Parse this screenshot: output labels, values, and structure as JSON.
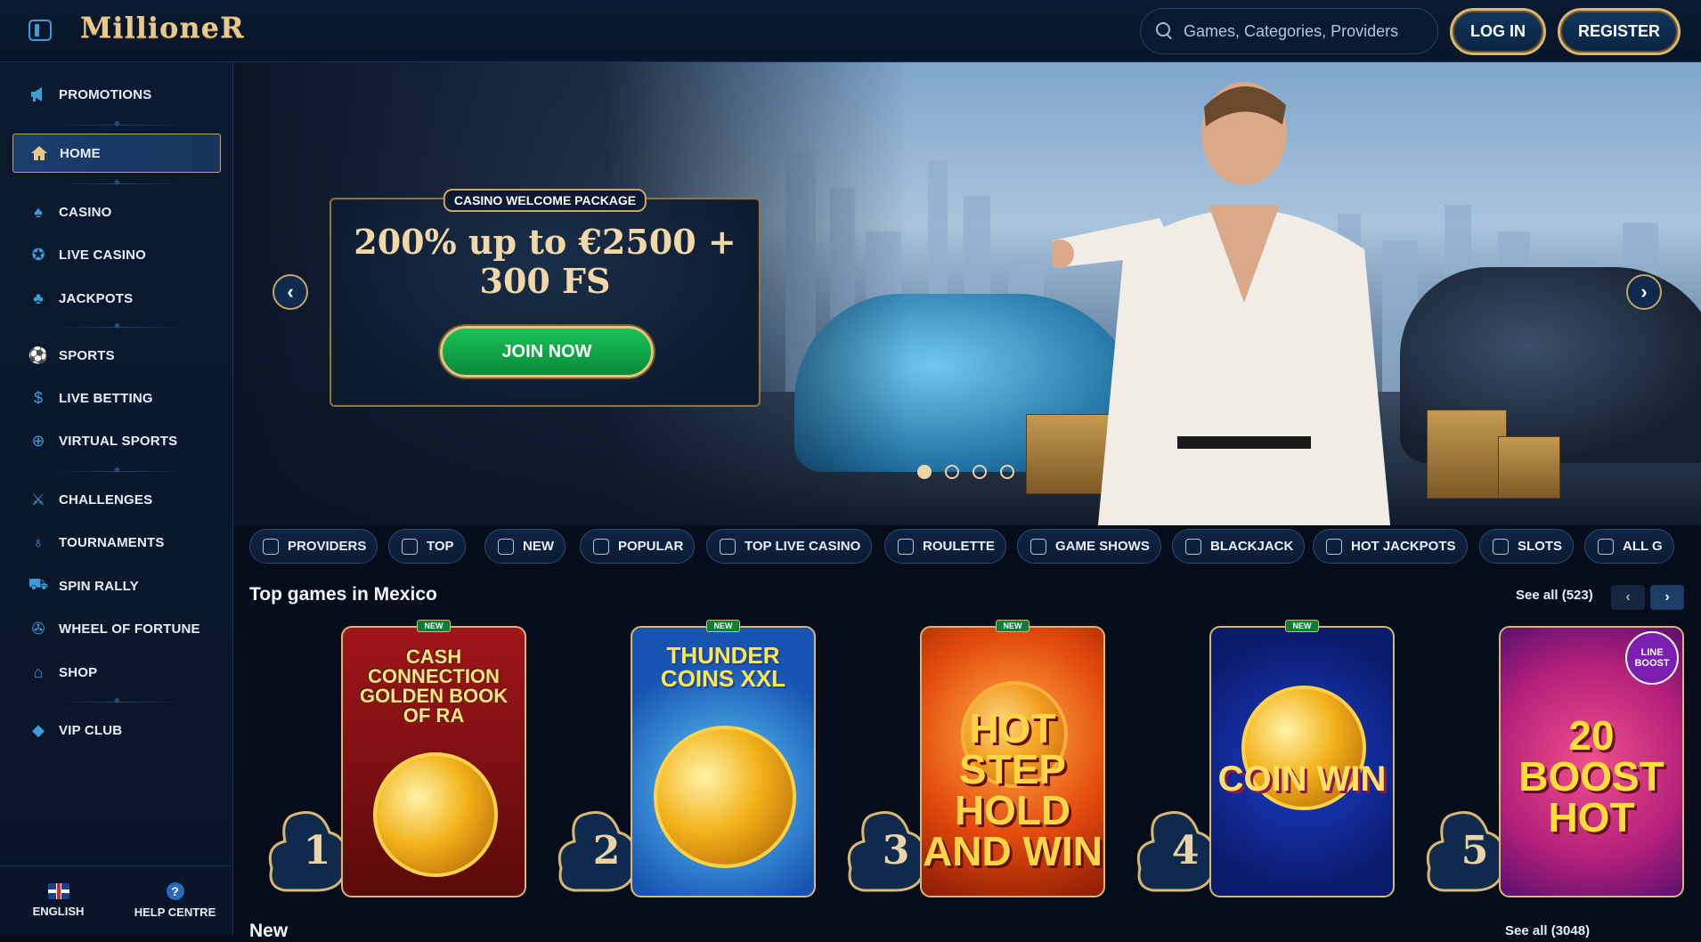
{
  "header": {
    "brand": "MillioneR",
    "search_placeholder": "Games, Categories, Providers",
    "login": "LOG IN",
    "register": "REGISTER"
  },
  "sidebar": {
    "items": [
      {
        "label": "PROMOTIONS",
        "icon": "megaphone-icon"
      },
      {
        "label": "HOME",
        "icon": "home-icon",
        "active": true
      },
      {
        "label": "CASINO",
        "icon": "spade-icon"
      },
      {
        "label": "LIVE CASINO",
        "icon": "chip-icon"
      },
      {
        "label": "JACKPOTS",
        "icon": "clover-icon"
      },
      {
        "label": "SPORTS",
        "icon": "soccer-ball-icon"
      },
      {
        "label": "LIVE BETTING",
        "icon": "live-coin-icon"
      },
      {
        "label": "VIRTUAL SPORTS",
        "icon": "virtual-globe-icon"
      },
      {
        "label": "CHALLENGES",
        "icon": "crossed-swords-icon"
      },
      {
        "label": "TOURNAMENTS",
        "icon": "medal-icon"
      },
      {
        "label": "SPIN RALLY",
        "icon": "race-car-icon"
      },
      {
        "label": "WHEEL OF FORTUNE",
        "icon": "wheel-icon"
      },
      {
        "label": "SHOP",
        "icon": "basket-icon"
      },
      {
        "label": "VIP CLUB",
        "icon": "diamond-icon"
      }
    ],
    "language": "ENGLISH",
    "help": "HELP CENTRE"
  },
  "hero": {
    "tag": "CASINO WELCOME PACKAGE",
    "title": "200% up to €2500 + 300 FS",
    "cta": "JOIN NOW",
    "slides": 4,
    "active_slide": 1
  },
  "chips": [
    "PROVIDERS",
    "TOP",
    "NEW",
    "POPULAR",
    "TOP LIVE CASINO",
    "ROULETTE",
    "GAME SHOWS",
    "BLACKJACK",
    "HOT JACKPOTS",
    "SLOTS",
    "ALL G"
  ],
  "top_games": {
    "title": "Top games in Mexico",
    "see_all": "See all (523)",
    "games": [
      {
        "rank": "1",
        "title": "CASH CONNECTION GOLDEN BOOK OF RA",
        "badge": "NEW"
      },
      {
        "rank": "2",
        "title": "THUNDER COINS XXL",
        "badge": "NEW"
      },
      {
        "rank": "3",
        "title": "HOT STEP HOLD AND WIN",
        "badge": "NEW"
      },
      {
        "rank": "4",
        "title": "COIN WIN",
        "badge": "NEW"
      },
      {
        "rank": "5",
        "title": "20 BOOST HOT",
        "badge": "LINE BOOST"
      }
    ]
  },
  "new_games": {
    "title": "New",
    "see_all": "See all (3048)"
  },
  "colors": {
    "accent": "#c9a55e",
    "primary_blue": "#3f9bd9",
    "join_green": "#12a84a",
    "background": "#050d1a"
  }
}
